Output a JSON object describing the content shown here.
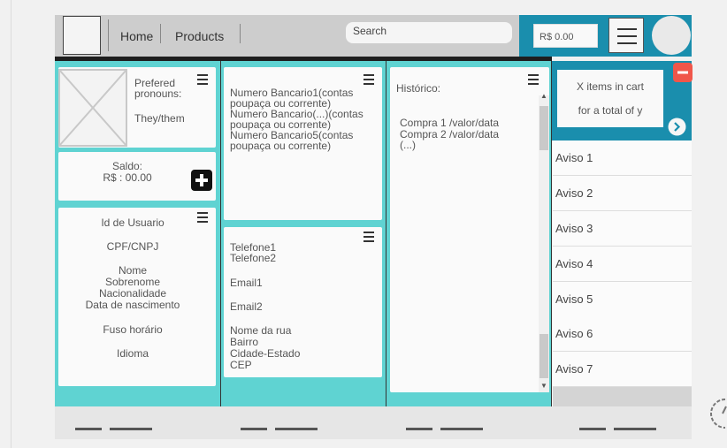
{
  "nav": {
    "home": "Home",
    "products": "Products"
  },
  "search": {
    "placeholder": "Search"
  },
  "wallet": {
    "amount": "R$ 0.00"
  },
  "profile": {
    "pronouns_label": "Prefered pronouns:",
    "pronouns_value": "They/them",
    "balance_label": "Saldo:",
    "balance_value": "R$ : 00.00",
    "fields": [
      "Id de Usuario",
      "CPF/CNPJ",
      "Nome",
      "Sobrenome",
      "Nacionalidade",
      "Data de nascimento",
      "Fuso horário",
      "Idioma"
    ]
  },
  "bank": {
    "accounts": [
      "Numero Bancario1(contas",
      "poupaça ou corrente)",
      "Numero Bancario(...)(contas",
      "poupaça ou corrente)",
      "Numero Bancario5(contas",
      "poupaça ou corrente)"
    ]
  },
  "contact": {
    "phone1": "Telefone1",
    "phone2": "Telefone2",
    "email1": "Email1",
    "email2": "Email2",
    "street": "Nome da rua",
    "district": "Bairro",
    "city": "Cidade-Estado",
    "zip": "CEP"
  },
  "history": {
    "title": "Histórico:",
    "items": [
      "Compra 1 /valor/data",
      "Compra 2 /valor/data",
      "(...)"
    ]
  },
  "cart": {
    "line1": "X items in cart",
    "line2": "for a total of y"
  },
  "notices": [
    "Aviso 1",
    "Aviso 2",
    "Aviso 3",
    "Aviso 4",
    "Aviso 5",
    "Aviso 6",
    "Aviso 7"
  ],
  "colors": {
    "teal": "#5fd3d2",
    "header_blue": "#1a8ead",
    "remove_red": "#f0564a"
  }
}
